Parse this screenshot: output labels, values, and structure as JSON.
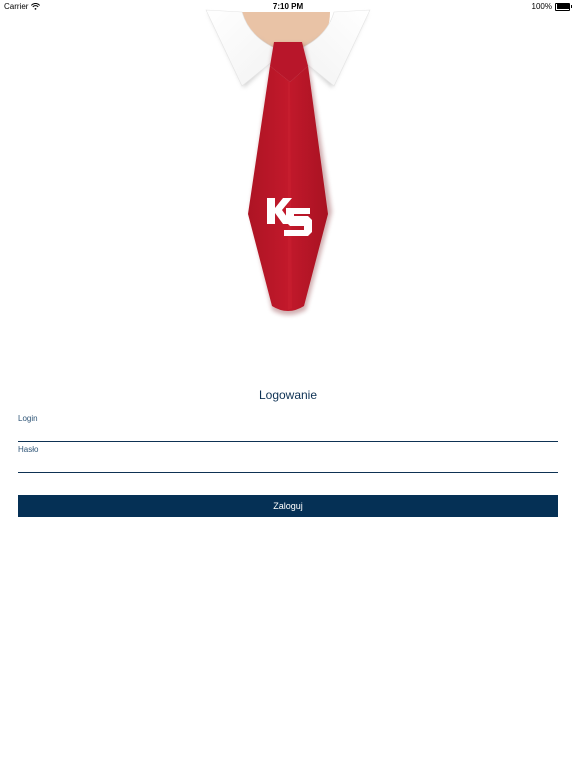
{
  "status_bar": {
    "carrier": "Carrier",
    "time": "7:10 PM",
    "battery": "100%",
    "battery_level": 1.0
  },
  "logo": {
    "text": "KS"
  },
  "login_form": {
    "title": "Logowanie",
    "login_label": "Login",
    "login_value": "",
    "password_label": "Hasło",
    "password_value": "",
    "submit_label": "Zaloguj"
  },
  "colors": {
    "primary": "#053055",
    "tie_red": "#c0182a",
    "skin": "#e8c4a8"
  },
  "icons": {
    "wifi": "wifi-icon",
    "battery": "battery-icon"
  }
}
